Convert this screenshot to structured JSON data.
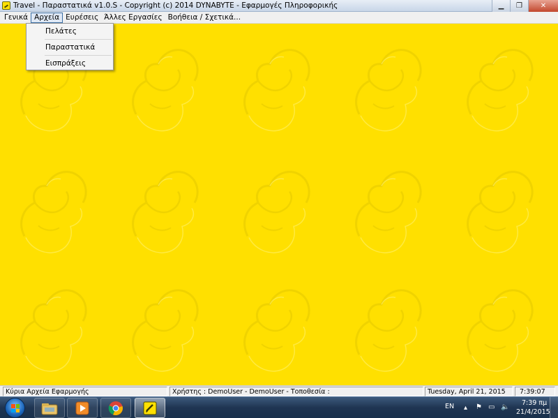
{
  "window": {
    "title": "Travel - Παραστατικά  v1.0.S  - Copyright (c) 2014  DYNABYTE - Εφαρμογές Πληροφορικής",
    "minimize_glyph": "▁",
    "maximize_glyph": "❐",
    "close_glyph": "✕"
  },
  "menubar": {
    "items": [
      {
        "label": "Γενικά"
      },
      {
        "label": "Αρχεία"
      },
      {
        "label": "Ευρέσεις"
      },
      {
        "label": "Άλλες Εργασίες"
      },
      {
        "label": "Βοήθεια / Σχετικά..."
      }
    ]
  },
  "dropdown": {
    "items": [
      {
        "label": "Πελάτες"
      },
      {
        "label": "Παραστατικά"
      },
      {
        "label": "Εισπράξεις"
      }
    ]
  },
  "statusbar": {
    "panels": [
      {
        "text": "Κύρια Αρχεία Εφαρμογής"
      },
      {
        "text": "Χρήστης : DemoUser  -  DemoUser  -  Τοποθεσία :"
      },
      {
        "text": "Tuesday, April 21, 2015"
      },
      {
        "text": "7:39:07"
      }
    ]
  },
  "taskbar": {
    "language": "EN",
    "time": "7:39 πμ",
    "date": "21/4/2015",
    "icons": [
      "file-explorer-icon",
      "media-player-icon",
      "chrome-icon",
      "travel-app-icon"
    ]
  },
  "colors": {
    "workspace_background": "#ffe000",
    "watermark": "#f2d400"
  }
}
